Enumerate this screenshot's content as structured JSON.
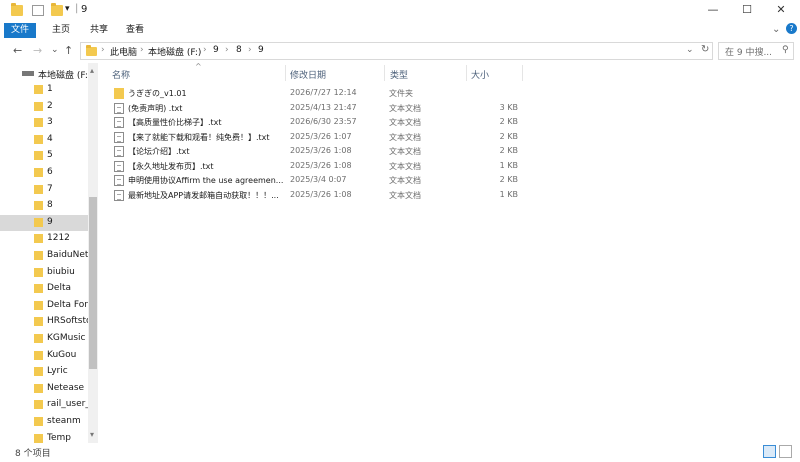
{
  "window": {
    "title": "9",
    "minimize": "—",
    "maximize": "☐",
    "close": "✕",
    "qa_dropdown": "▾",
    "separator": "|"
  },
  "ribbon": {
    "tabs": [
      "文件",
      "主页",
      "共享",
      "查看"
    ],
    "collapse": "⌄",
    "help": "?"
  },
  "nav": {
    "back": "←",
    "forward": "→",
    "recent": "⌄",
    "up": "↑"
  },
  "address": {
    "crumbs": [
      "此电脑",
      "本地磁盘 (F:)",
      "9",
      "8",
      "9"
    ],
    "sep": "›",
    "dropdown": "⌄",
    "refresh": "↻"
  },
  "search": {
    "placeholder": "在 9 中搜... ",
    "icon": "⚲"
  },
  "sidebar": {
    "drive": "本地磁盘 (F:)",
    "items": [
      "1",
      "2",
      "3",
      "4",
      "5",
      "6",
      "7",
      "8",
      "9",
      "1212",
      "BaiduNetd",
      "biubiu",
      "Delta",
      "Delta Forc",
      "HRSoftsto",
      "KGMusic",
      "KuGou",
      "Lyric",
      "Netease",
      "rail_user_c",
      "steanm",
      "Temp"
    ],
    "selected_index": 8,
    "scroll_up": "▴",
    "scroll_down": "▾"
  },
  "columns": {
    "sort_arrow": "^",
    "name": "名称",
    "date": "修改日期",
    "type": "类型",
    "size": "大小"
  },
  "files": [
    {
      "icon": "folder-icon",
      "name": "うぎぎの_v1.01",
      "date": "2026/7/27 12:14",
      "type": "文件夹",
      "size": ""
    },
    {
      "icon": "text-file-icon",
      "name": "(免责声明) .txt",
      "date": "2025/4/13 21:47",
      "type": "文本文档",
      "size": "3 KB"
    },
    {
      "icon": "text-file-icon",
      "name": "【高质量性价比梯子】.txt",
      "date": "2026/6/30 23:57",
      "type": "文本文档",
      "size": "2 KB"
    },
    {
      "icon": "text-file-icon",
      "name": "【来了就能下载和观看！纯免费！】.txt",
      "date": "2025/3/26 1:07",
      "type": "文本文档",
      "size": "2 KB"
    },
    {
      "icon": "text-file-icon",
      "name": "【论坛介绍】.txt",
      "date": "2025/3/26 1:08",
      "type": "文本文档",
      "size": "2 KB"
    },
    {
      "icon": "text-file-icon",
      "name": "【永久地址发布页】.txt",
      "date": "2025/3/26 1:08",
      "type": "文本文档",
      "size": "1 KB"
    },
    {
      "icon": "text-file-icon",
      "name": "申明使用协议Affirm the use agreemen...",
      "date": "2025/3/4 0:07",
      "type": "文本文档",
      "size": "2 KB"
    },
    {
      "icon": "text-file-icon",
      "name": "最新地址及APP请发邮箱自动获取！！！...",
      "date": "2025/3/26 1:08",
      "type": "文本文档",
      "size": "1 KB"
    }
  ],
  "status": {
    "count": "8 个项目"
  },
  "colors": {
    "accent": "#1979ca",
    "folder": "#f3c94f",
    "selected": "#d9d9d9"
  }
}
